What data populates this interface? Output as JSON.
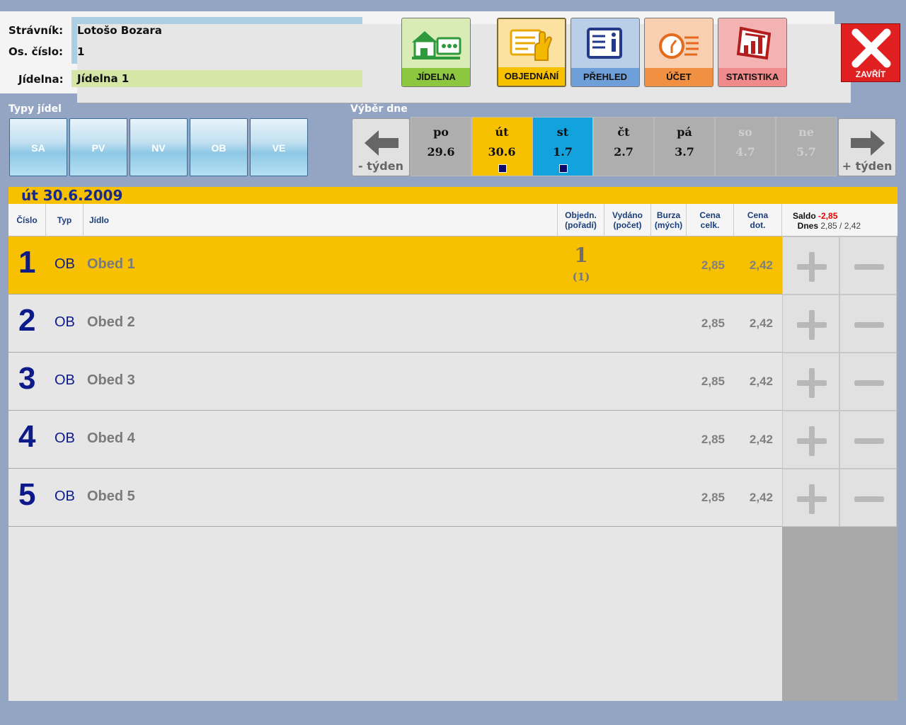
{
  "header": {
    "stravnik_label": "Strávník:",
    "stravnik_value": "Lotošo Bozara",
    "os_cislo_label": "Os. číslo:",
    "os_cislo_value": "1",
    "jidelna_label": "Jídelna:",
    "jidelna_value": "Jídelna 1"
  },
  "nav": {
    "jidelna": "JÍDELNA",
    "objednani": "OBJEDNÁNÍ",
    "prehled": "PŘEHLED",
    "ucet": "ÚČET",
    "statistika": "STATISTIKA",
    "zavrit": "ZAVŘÍT"
  },
  "types": {
    "label": "Typy jídel",
    "items": [
      "SA",
      "PV",
      "NV",
      "OB",
      "VE"
    ]
  },
  "days": {
    "label": "Výběr dne",
    "prev_week": "- týden",
    "next_week": "+ týden",
    "items": [
      {
        "name": "po",
        "date": "29.6"
      },
      {
        "name": "út",
        "date": "30.6"
      },
      {
        "name": "st",
        "date": "1.7"
      },
      {
        "name": "čt",
        "date": "2.7"
      },
      {
        "name": "pá",
        "date": "3.7"
      },
      {
        "name": "so",
        "date": "4.7"
      },
      {
        "name": "ne",
        "date": "5.7"
      }
    ]
  },
  "selected_date": "út 30.6.2009",
  "columns": {
    "cislo": "Číslo",
    "typ": "Typ",
    "jidlo": "Jídlo",
    "objedn_1": "Objedn.",
    "objedn_2": "(pořadí)",
    "vydano_1": "Vydáno",
    "vydano_2": "(počet)",
    "burza_1": "Burza",
    "burza_2": "(mých)",
    "cena_celk_1": "Cena",
    "cena_celk_2": "celk.",
    "cena_dot_1": "Cena",
    "cena_dot_2": "dot."
  },
  "saldo": {
    "label": "Saldo",
    "value": "-2,85",
    "dnes_label": "Dnes",
    "dnes_value": "2,85 / 2,42"
  },
  "meals": [
    {
      "num": "1",
      "type": "OB",
      "name": "Obed 1",
      "ordered": "1",
      "order_pos": "(1)",
      "price_total": "2,85",
      "price_sub": "2,42"
    },
    {
      "num": "2",
      "type": "OB",
      "name": "Obed 2",
      "ordered": "",
      "order_pos": "",
      "price_total": "2,85",
      "price_sub": "2,42"
    },
    {
      "num": "3",
      "type": "OB",
      "name": "Obed 3",
      "ordered": "",
      "order_pos": "",
      "price_total": "2,85",
      "price_sub": "2,42"
    },
    {
      "num": "4",
      "type": "OB",
      "name": "Obed 4",
      "ordered": "",
      "order_pos": "",
      "price_total": "2,85",
      "price_sub": "2,42"
    },
    {
      "num": "5",
      "type": "OB",
      "name": "Obed 5",
      "ordered": "",
      "order_pos": "",
      "price_total": "2,85",
      "price_sub": "2,42"
    }
  ],
  "colors": {
    "background": "#94a5c4",
    "selected_yellow": "#f7c000",
    "current_blue": "#12a3df",
    "close_red": "#e02020"
  }
}
